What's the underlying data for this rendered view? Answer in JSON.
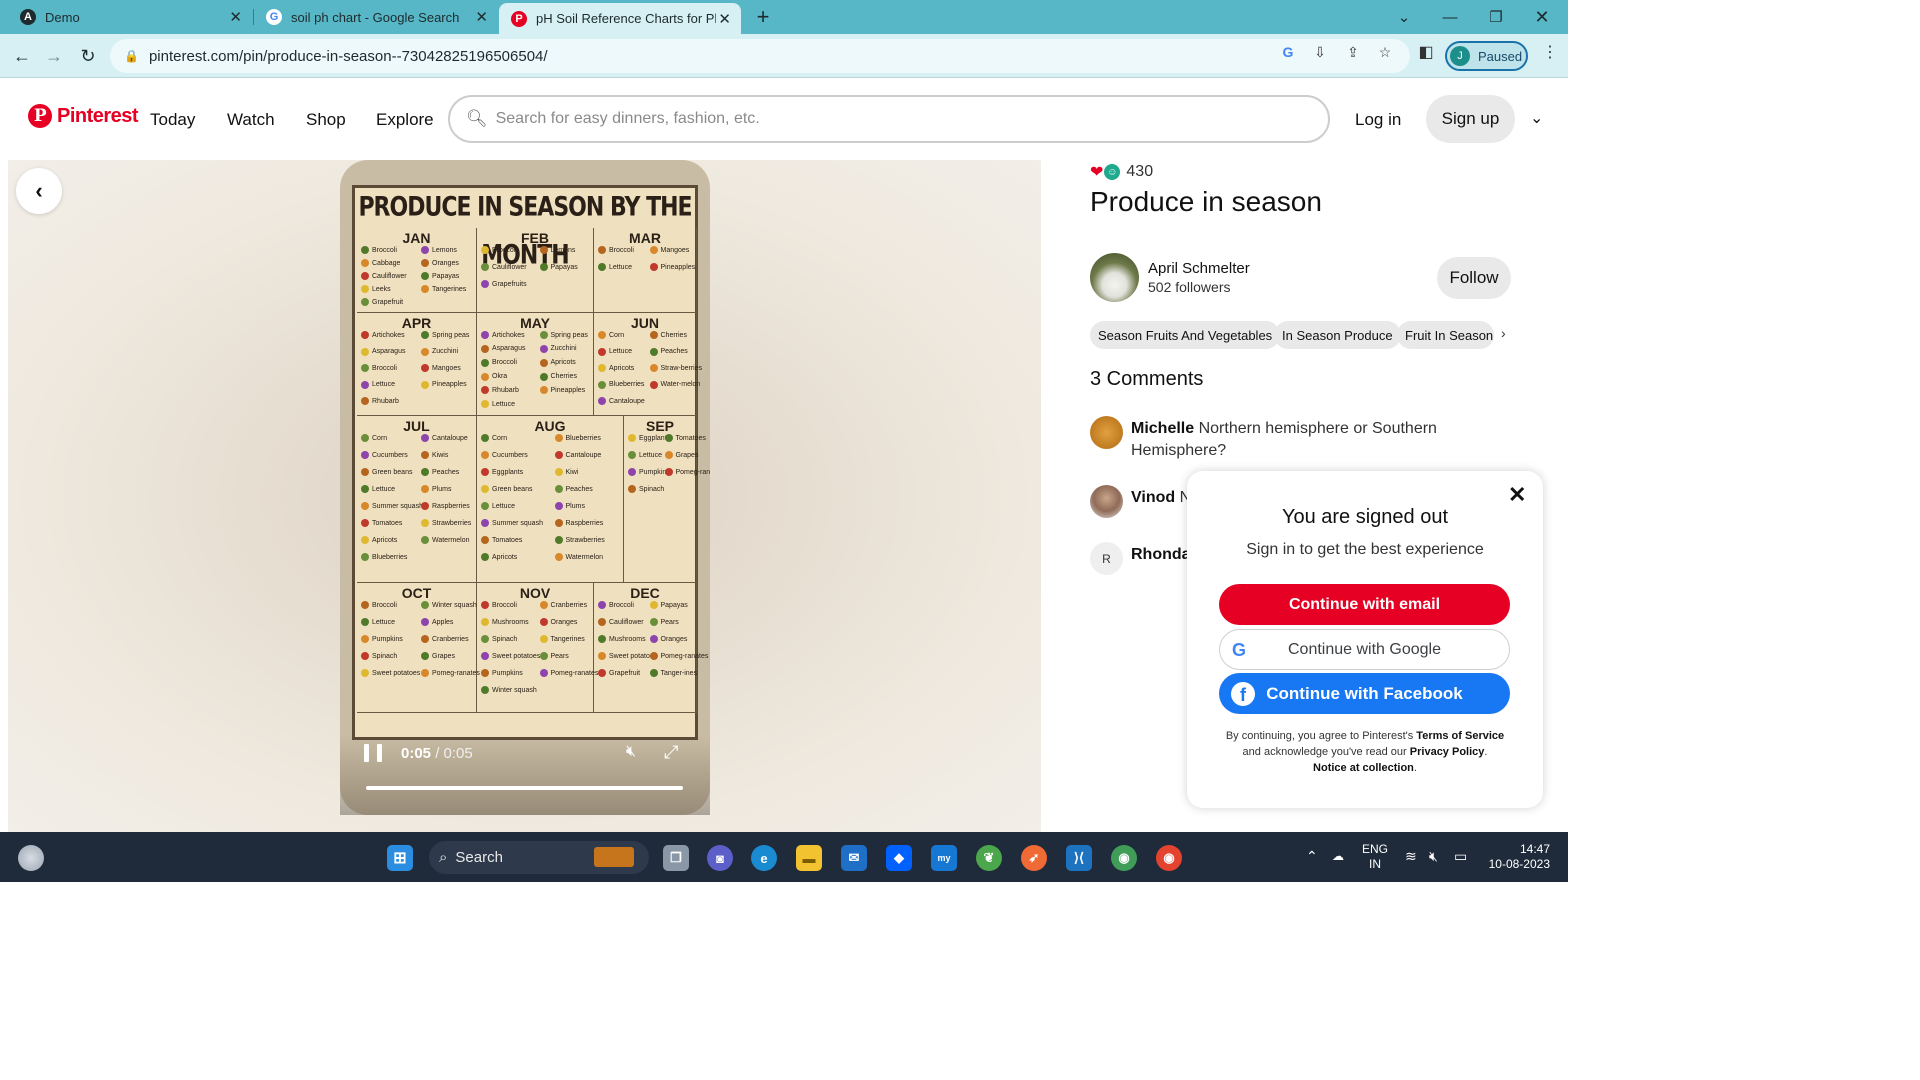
{
  "browser": {
    "tabs": [
      {
        "title": "Demo",
        "favicon": "A"
      },
      {
        "title": "soil ph chart - Google Search",
        "favicon": "G"
      },
      {
        "title": "pH Soil Reference Charts for Plan",
        "favicon": "P"
      }
    ],
    "url": "pinterest.com/pin/produce-in-season--730428251965065​04/",
    "profile_initial": "J",
    "profile_status": "Paused"
  },
  "header": {
    "logo_text": "Pinterest",
    "nav": [
      "Today",
      "Watch",
      "Shop",
      "Explore"
    ],
    "search_placeholder": "Search for easy dinners, fashion, etc.",
    "login": "Log in",
    "signup": "Sign up"
  },
  "video": {
    "poster_title": "PRODUCE IN SEASON BY THE MONTH",
    "months": [
      {
        "name": "JAN",
        "items": [
          "Broccoli",
          "Cabbage",
          "Cauliflower",
          "Leeks",
          "Grapefruit",
          "Lemons",
          "Oranges",
          "Papayas",
          "Tangerines"
        ]
      },
      {
        "name": "FEB",
        "items": [
          "Broccoli",
          "Cauliflower",
          "Grapefruits",
          "Lemons",
          "Papayas"
        ]
      },
      {
        "name": "MAR",
        "items": [
          "Broccoli",
          "Lettuce",
          "Mangoes",
          "Pineapples"
        ]
      },
      {
        "name": "APR",
        "items": [
          "Artichokes",
          "Asparagus",
          "Broccoli",
          "Lettuce",
          "Rhubarb",
          "Spring peas",
          "Zucchini",
          "Mangoes",
          "Pineapples"
        ]
      },
      {
        "name": "MAY",
        "items": [
          "Artichokes",
          "Asparagus",
          "Broccoli",
          "Okra",
          "Rhubarb",
          "Lettuce",
          "Spring peas",
          "Zucchini",
          "Apricots",
          "Cherries",
          "Pineapples"
        ]
      },
      {
        "name": "JUN",
        "items": [
          "Corn",
          "Lettuce",
          "Apricots",
          "Blueberries",
          "Cantaloupe",
          "Cherries",
          "Peaches",
          "Straw-berries",
          "Water-melon"
        ]
      },
      {
        "name": "JUL",
        "items": [
          "Corn",
          "Cucumbers",
          "Green beans",
          "Lettuce",
          "Summer squash",
          "Tomatoes",
          "Apricots",
          "Blueberries",
          "Cantaloupe",
          "Kiwis",
          "Peaches",
          "Plums",
          "Raspberries",
          "Strawberries",
          "Watermelon"
        ]
      },
      {
        "name": "AUG",
        "items": [
          "Corn",
          "Cucumbers",
          "Eggplants",
          "Green beans",
          "Lettuce",
          "Summer squash",
          "Tomatoes",
          "Apricots",
          "Blueberries",
          "Cantaloupe",
          "Kiwi",
          "Peaches",
          "Plums",
          "Raspberries",
          "Strawberries",
          "Watermelon"
        ]
      },
      {
        "name": "SEP",
        "items": [
          "Eggplant",
          "Lettuce",
          "Pumpkin",
          "Spinach",
          "Tomatoes",
          "Grapes",
          "Pomeg-ranates"
        ]
      },
      {
        "name": "OCT",
        "items": [
          "Broccoli",
          "Lettuce",
          "Pumpkins",
          "Spinach",
          "Sweet potatoes",
          "Winter squash",
          "Apples",
          "Cranberries",
          "Grapes",
          "Pomeg-ranates"
        ]
      },
      {
        "name": "NOV",
        "items": [
          "Broccoli",
          "Mushrooms",
          "Spinach",
          "Sweet potatoes",
          "Pumpkins",
          "Winter squash",
          "Cranberries",
          "Oranges",
          "Tangerines",
          "Pears",
          "Pomeg-ranates"
        ]
      },
      {
        "name": "DEC",
        "items": [
          "Broccoli",
          "Cauliflower",
          "Mushrooms",
          "Sweet potatoes",
          "Grapefruit",
          "Papayas",
          "Pears",
          "Oranges",
          "Pomeg-ranates",
          "Tanger-ines"
        ]
      }
    ],
    "current_time": "0:05",
    "duration": "/ 0:05",
    "progress": 1.0
  },
  "pin": {
    "reaction_count": "430",
    "title": "Produce in season",
    "author_name": "April Schmelter",
    "author_followers": "502 followers",
    "follow_label": "Follow",
    "tags": [
      "Season Fruits And Vegetables",
      "In Season Produce",
      "Fruit In Season"
    ],
    "comments_heading": "3 Comments",
    "comments": [
      {
        "author": "Michelle",
        "text": "Northern hemisphere or Southern Hemisphere?"
      },
      {
        "author": "Vinod",
        "text": "N"
      },
      {
        "author": "Rhonda",
        "text": "",
        "initial": "R"
      }
    ]
  },
  "popup": {
    "title": "You are signed out",
    "subtitle": "Sign in to get the best experience",
    "email_button": "Continue with email",
    "google_button": "Continue with Google",
    "facebook_button": "Continue with Facebook",
    "terms_1": "By continuing, you agree to Pinterest's",
    "terms_link1": "Terms of Service",
    "terms_2": "and acknowledge you've read our",
    "terms_link2": "Privacy Policy",
    "terms_link3": "Notice at collection"
  },
  "taskbar": {
    "search_label": "Search",
    "language": "ENG",
    "region": "IN",
    "time": "14:47",
    "date": "10-08-2023"
  },
  "colors": {
    "pinterest_red": "#e60023",
    "facebook_blue": "#1877f2",
    "chrome_frame": "#57b7c6"
  }
}
